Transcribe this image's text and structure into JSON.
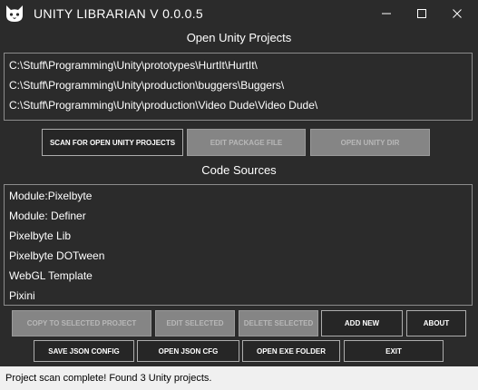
{
  "window": {
    "title": "UNITY LIBRARIAN V 0.0.0.5",
    "icon": "cat-icon"
  },
  "open_projects": {
    "label": "Open Unity Projects",
    "items": [
      "C:\\Stuff\\Programming\\Unity\\prototypes\\HurtIt\\HurtIt\\",
      "C:\\Stuff\\Programming\\Unity\\production\\buggers\\Buggers\\",
      "C:\\Stuff\\Programming\\Unity\\production\\Video Dude\\Video Dude\\"
    ]
  },
  "project_buttons": {
    "scan": "SCAN FOR OPEN UNITY PROJECTS",
    "edit_package": "EDIT PACKAGE FILE",
    "open_unity_dir": "OPEN UNITY DIR"
  },
  "code_sources": {
    "label": "Code Sources",
    "items": [
      "Module:Pixelbyte",
      "Module: Definer",
      "Pixelbyte Lib",
      "Pixelbyte DOTween",
      "WebGL Template",
      "Pixini"
    ]
  },
  "source_buttons": {
    "copy": "COPY TO SELECTED PROJECT",
    "edit": "EDIT SELECTED",
    "delete": "DELETE SELECTED",
    "add": "ADD NEW",
    "about": "ABOUT"
  },
  "bottom_buttons": {
    "save_json": "SAVE JSON CONFIG",
    "open_json": "OPEN JSON CFG",
    "open_exe": "OPEN EXE FOLDER",
    "exit": "EXIT"
  },
  "status": {
    "text": "Project scan complete! Found 3 Unity projects."
  },
  "colors": {
    "background": "#2b2b2b",
    "button": "#262626",
    "button_disabled": "#858585",
    "status_bar": "#f0f0f0"
  }
}
